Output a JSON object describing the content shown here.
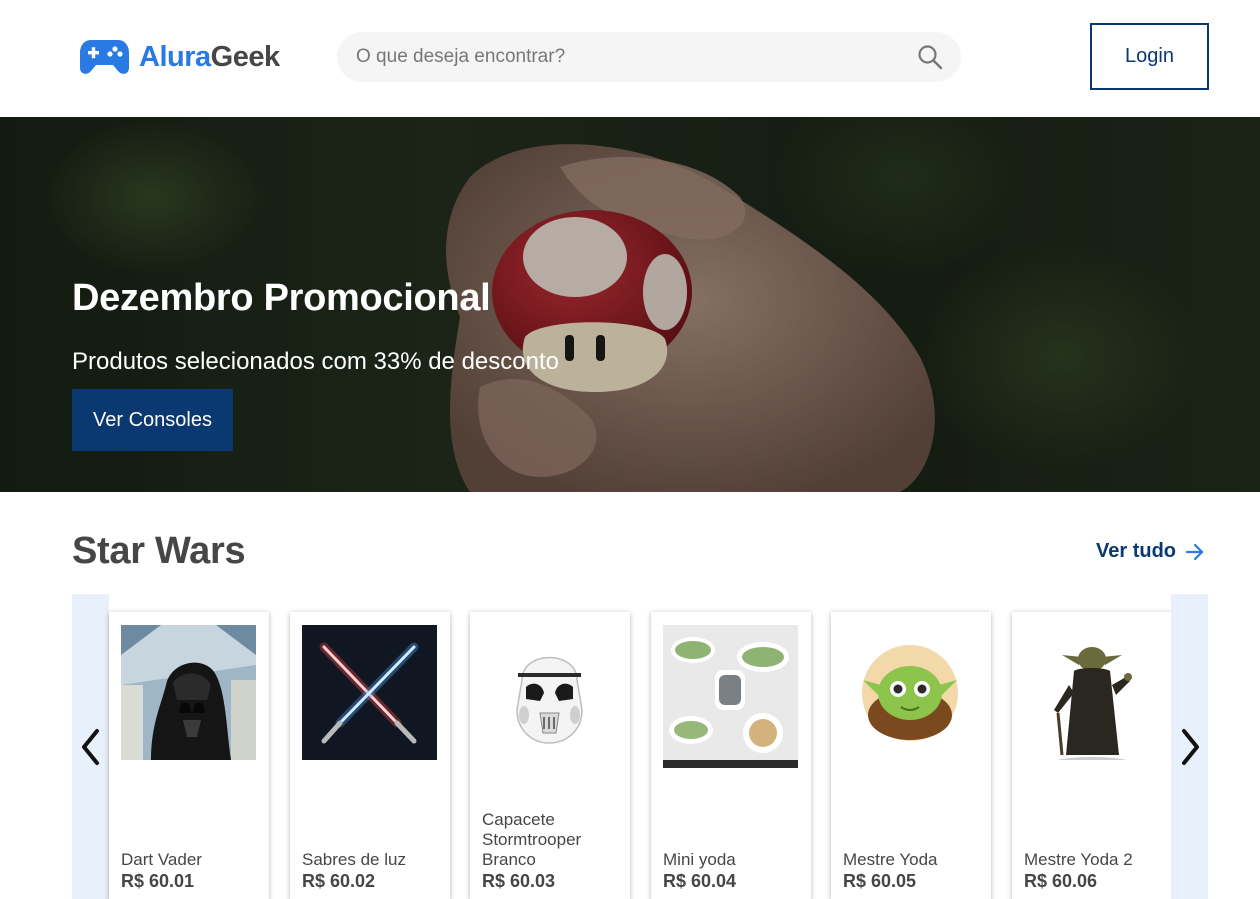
{
  "brand": {
    "part1": "Alura",
    "part2": "Geek",
    "accent": "#2a7ae4",
    "dark_blue": "#0a3871"
  },
  "search": {
    "placeholder": "O que deseja encontrar?",
    "icon": "search-icon"
  },
  "header": {
    "login_label": "Login"
  },
  "banner": {
    "title": "Dezembro Promocional",
    "subtitle": "Produtos selecionados com 33% de desconto",
    "button_label": "Ver Consoles"
  },
  "section": {
    "title": "Star Wars",
    "see_all_label": "Ver tudo",
    "products": [
      {
        "name": "Dart Vader",
        "price": "R$ 60.01",
        "image": "darth-vader-photo"
      },
      {
        "name": "Sabres de luz",
        "price": "R$ 60.02",
        "image": "lightsabers-image"
      },
      {
        "name": "Capacete Stormtrooper Branco",
        "price": "R$ 60.03",
        "image": "stormtrooper-helmet-image"
      },
      {
        "name": "Mini yoda",
        "price": "R$ 60.04",
        "image": "mini-yoda-stickers-image"
      },
      {
        "name": "Mestre Yoda",
        "price": "R$ 60.05",
        "image": "yoda-face-image"
      },
      {
        "name": "Mestre Yoda 2",
        "price": "R$ 60.06",
        "image": "yoda-figure-image"
      }
    ]
  }
}
